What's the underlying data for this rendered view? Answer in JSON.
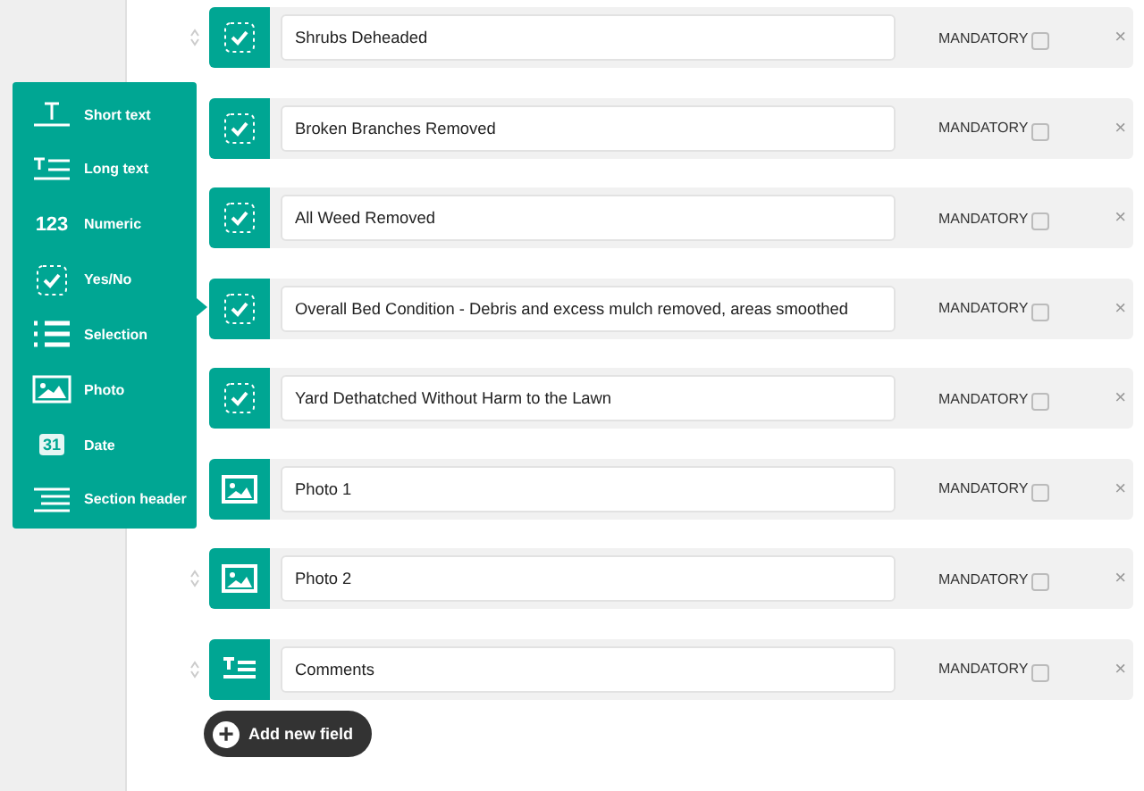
{
  "fields": [
    {
      "kind": "yes_no",
      "drag_handle": true,
      "label": "Shrubs Deheaded",
      "mandatory_label": "MANDATORY",
      "mandatory": false,
      "remove": "×"
    },
    {
      "kind": "yes_no",
      "label": "Broken Branches Removed",
      "mandatory_label": "MANDATORY",
      "mandatory": false,
      "remove": "×"
    },
    {
      "kind": "yes_no",
      "label": "All Weed Removed",
      "mandatory_label": "MANDATORY",
      "mandatory": false,
      "remove": "×"
    },
    {
      "kind": "yes_no",
      "label": "Overall Bed Condition - Debris and excess mulch removed, areas smoothed",
      "mandatory_label": "MANDATORY",
      "mandatory": false,
      "remove": "×"
    },
    {
      "kind": "yes_no",
      "label": "Yard Dethatched Without Harm to the Lawn",
      "mandatory_label": "MANDATORY",
      "mandatory": false,
      "remove": "×"
    },
    {
      "kind": "photo",
      "label": "Photo 1",
      "mandatory_label": "MANDATORY",
      "mandatory": false,
      "remove": "×"
    },
    {
      "kind": "photo",
      "drag_handle": true,
      "label": "Photo 2",
      "mandatory_label": "MANDATORY",
      "mandatory": false,
      "remove": "×"
    },
    {
      "kind": "long_text",
      "drag_handle": true,
      "label": "Comments",
      "mandatory_label": "MANDATORY",
      "mandatory": false,
      "remove": "×"
    }
  ],
  "type_menu": {
    "items": [
      {
        "kind": "short_text",
        "label": "Short text"
      },
      {
        "kind": "long_text",
        "label": "Long text"
      },
      {
        "kind": "numeric",
        "label": "Numeric",
        "glyph": "123"
      },
      {
        "kind": "yes_no",
        "label": "Yes/No"
      },
      {
        "kind": "selection",
        "label": "Selection"
      },
      {
        "kind": "photo",
        "label": "Photo"
      },
      {
        "kind": "date",
        "label": "Date",
        "glyph": "31"
      },
      {
        "kind": "section_header",
        "label": "Section header"
      }
    ]
  },
  "add_button": {
    "label": "Add new field",
    "icon": "+"
  }
}
